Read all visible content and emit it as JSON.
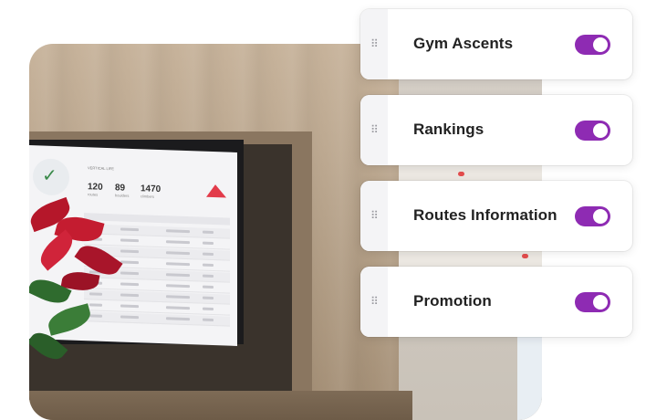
{
  "cards": [
    {
      "label": "Gym Ascents",
      "enabled": true
    },
    {
      "label": "Rankings",
      "enabled": true
    },
    {
      "label": "Routes Information",
      "enabled": true
    },
    {
      "label": "Promotion",
      "enabled": true
    }
  ],
  "icons": {
    "drag": "drag-handle-icon",
    "toggle": "toggle-switch"
  },
  "colors": {
    "toggle_on": "#8e2bb3",
    "card_bg": "#ffffff"
  },
  "tv_screen": {
    "title": "VERTICAL LIFE",
    "stats": [
      {
        "value": "120",
        "label": "routes"
      },
      {
        "value": "89",
        "label": "boulders"
      },
      {
        "value": "1470",
        "label": "climbers"
      }
    ]
  }
}
